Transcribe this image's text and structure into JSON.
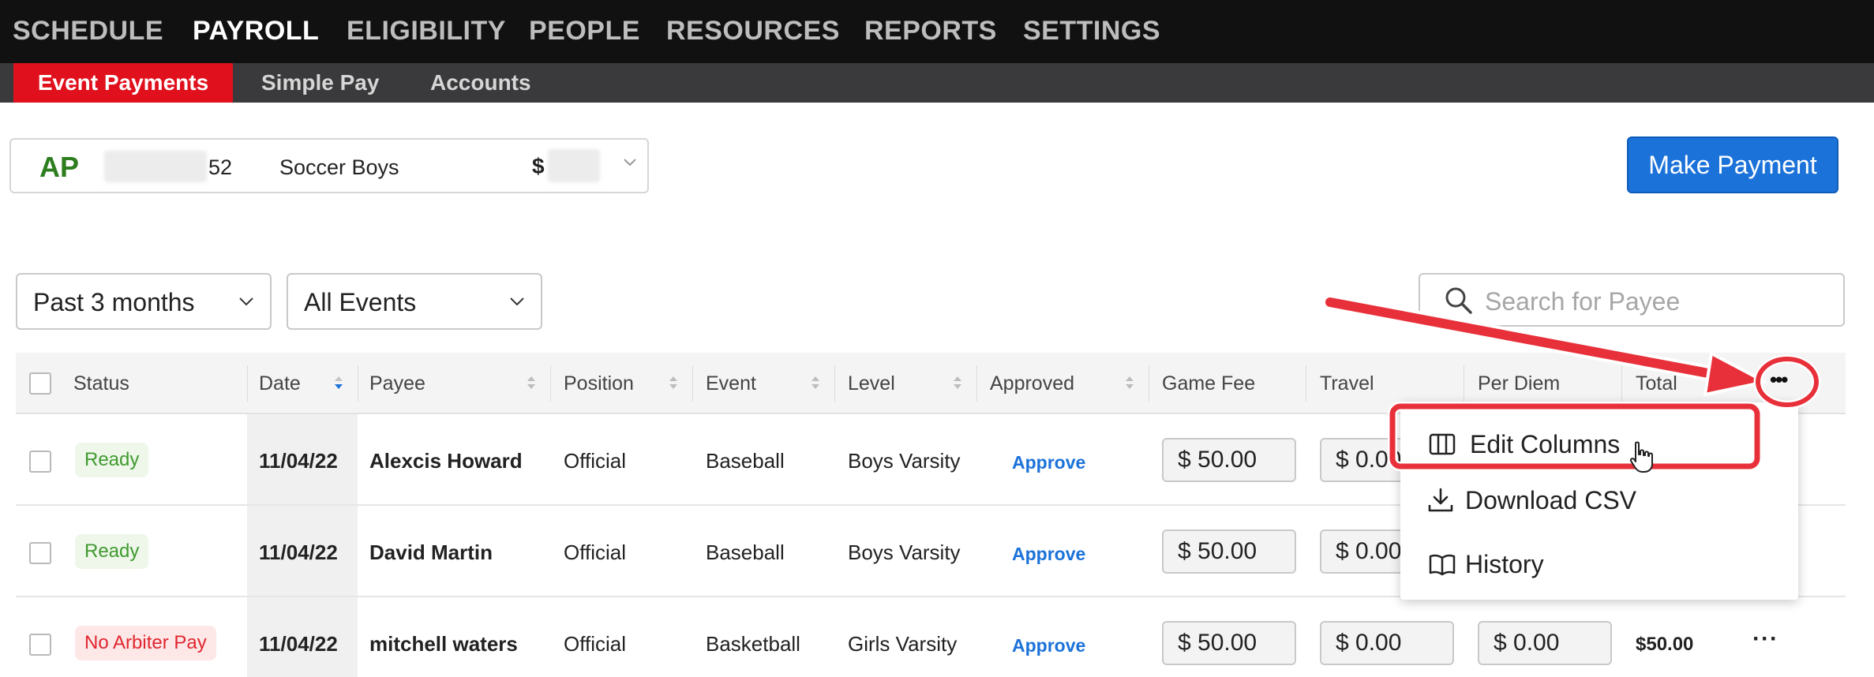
{
  "topnav": {
    "items": [
      "SCHEDULE",
      "PAYROLL",
      "ELIGIBILITY",
      "PEOPLE",
      "RESOURCES",
      "REPORTS",
      "SETTINGS"
    ],
    "active": "PAYROLL"
  },
  "subnav": {
    "tabs": [
      "Event Payments",
      "Simple Pay",
      "Accounts"
    ],
    "active": "Event Payments"
  },
  "account": {
    "code": "AP",
    "number_suffix": "52",
    "name": "Soccer Boys",
    "currency": "$"
  },
  "make_payment_label": "Make Payment",
  "filters": {
    "date_range": "Past 3 months",
    "events": "All Events"
  },
  "search": {
    "placeholder": "Search for Payee"
  },
  "table": {
    "headers": [
      "Status",
      "Date",
      "Payee",
      "Position",
      "Event",
      "Level",
      "Approved",
      "Game Fee",
      "Travel",
      "Per Diem",
      "Total"
    ],
    "rows": [
      {
        "status": "Ready",
        "status_kind": "ready",
        "date": "11/04/22",
        "payee": "Alexcis Howard",
        "position": "Official",
        "event": "Baseball",
        "level": "Boys Varsity",
        "approved": "Approve",
        "game_fee": "$ 50.00",
        "travel": "$ 0.00",
        "per_diem": "",
        "total": ""
      },
      {
        "status": "Ready",
        "status_kind": "ready",
        "date": "11/04/22",
        "payee": "David Martin",
        "position": "Official",
        "event": "Baseball",
        "level": "Boys Varsity",
        "approved": "Approve",
        "game_fee": "$ 50.00",
        "travel": "$ 0.00",
        "per_diem": "",
        "total": ""
      },
      {
        "status": "No Arbiter Pay",
        "status_kind": "noarb",
        "date": "11/04/22",
        "payee": "mitchell waters",
        "position": "Official",
        "event": "Basketball",
        "level": "Girls Varsity",
        "approved": "Approve",
        "game_fee": "$ 50.00",
        "travel": "$ 0.00",
        "per_diem": "$ 0.00",
        "total": "$50.00",
        "row_more": "···"
      }
    ]
  },
  "more_menu": {
    "trigger_label": "•••",
    "items": [
      {
        "label": "Edit Columns",
        "icon": "columns-icon"
      },
      {
        "label": "Download CSV",
        "icon": "download-icon"
      },
      {
        "label": "History",
        "icon": "book-icon"
      }
    ]
  },
  "colors": {
    "nav_bg": "#111111",
    "subnav_bg": "#3a3a3c",
    "active_tab": "#e0101c",
    "primary": "#1b72d9",
    "account_green": "#2e7d1e",
    "annotation_red": "#e8303a"
  }
}
